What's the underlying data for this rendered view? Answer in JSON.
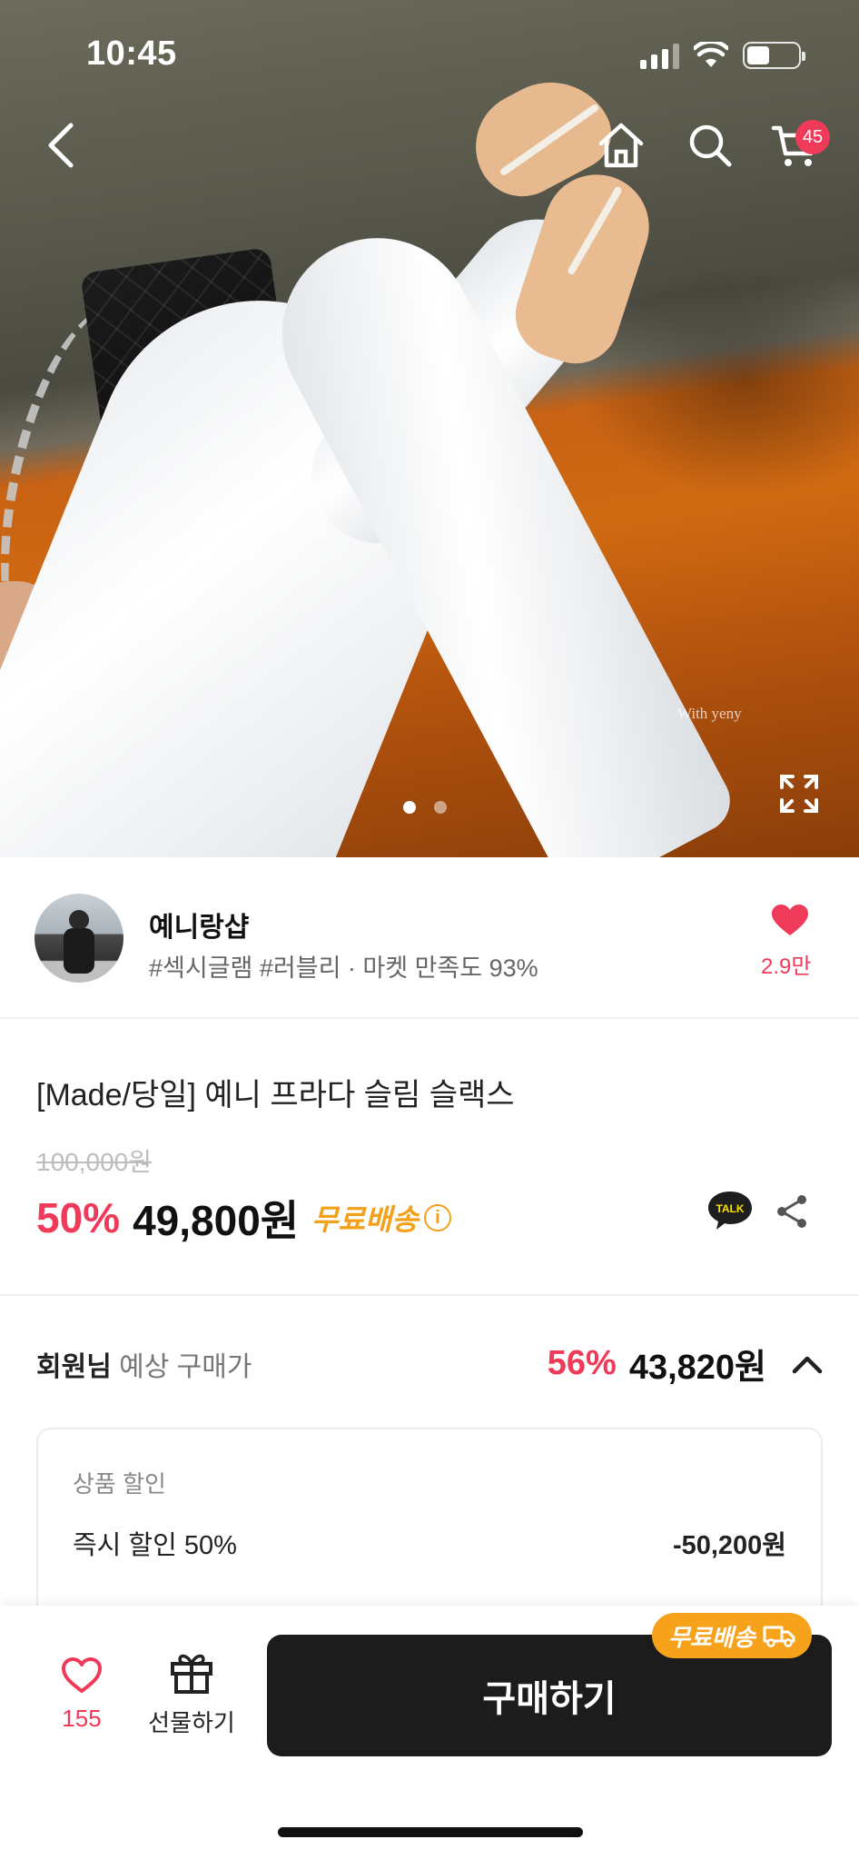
{
  "status_bar": {
    "time": "10:45"
  },
  "header": {
    "cart_count": "45"
  },
  "hero": {
    "watermark": "With yeny",
    "image_count": 2,
    "active_index": 0
  },
  "seller": {
    "name": "예니랑샵",
    "tags": "#섹시글램 #러블리 · 마켓 만족도 93%",
    "likes": "2.9만"
  },
  "product": {
    "title": "[Made/당일] 예니 프라다 슬림 슬랙스",
    "original_price": "100,000원",
    "discount": "50%",
    "price": "49,800원",
    "free_shipping": "무료배송",
    "info_icon": "i"
  },
  "member_price": {
    "label_bold": "회원님",
    "label": " 예상 구매가",
    "discount": "56%",
    "price": "43,820원"
  },
  "breakdown": {
    "header": "상품 할인",
    "rows": [
      {
        "label": "즉시 할인 50%",
        "value": "-50,200원"
      }
    ]
  },
  "bottom_bar": {
    "wish_count": "155",
    "gift_label": "선물하기",
    "buy_label": "구매하기",
    "ship_badge": "무료배송"
  },
  "colors": {
    "accent": "#f03a5a",
    "shipping": "#f3a01b",
    "buy_button": "#1c1c1c"
  }
}
